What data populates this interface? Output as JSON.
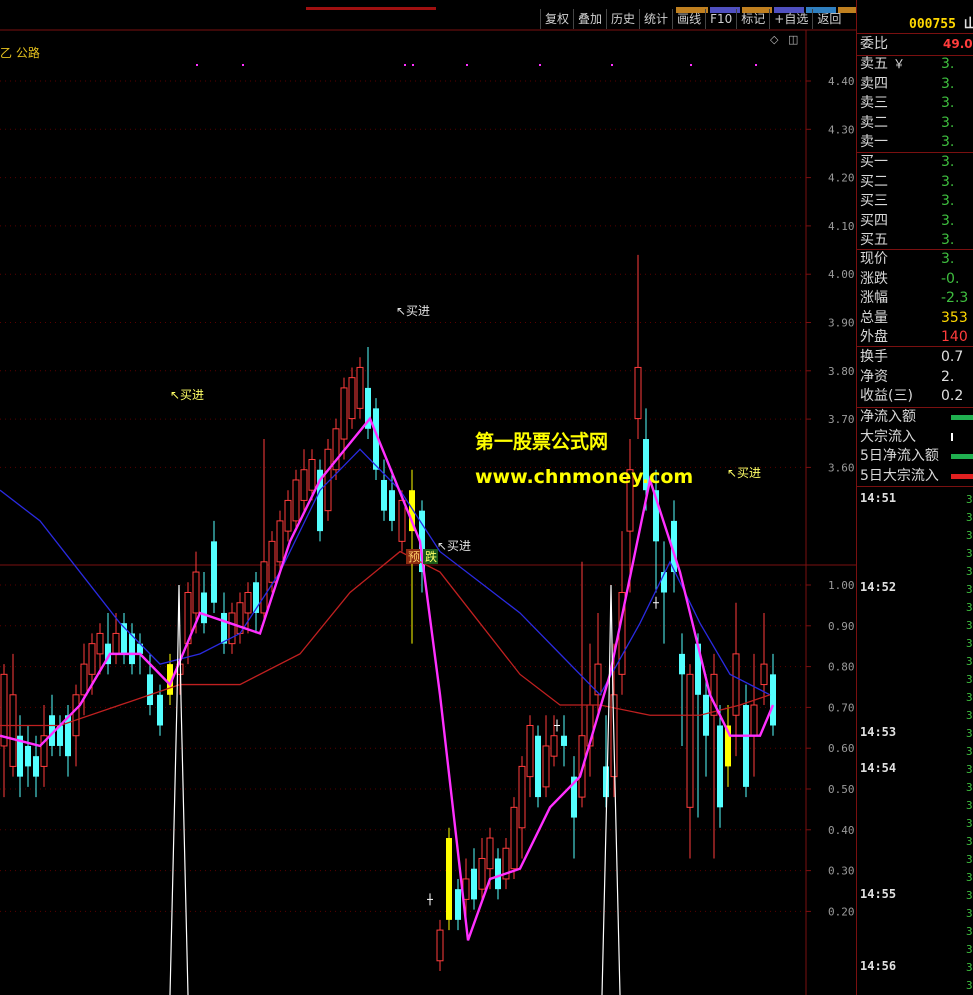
{
  "toolbar": [
    "复权",
    "叠加",
    "历史",
    "统计",
    "画线",
    "F10",
    "标记",
    "+自选",
    "返回"
  ],
  "indicator_name": "乙 公路",
  "corner_icons": {
    "diamond": "diamond-icon",
    "square": "window-icon"
  },
  "watermark": {
    "line1": "第一股票公式网",
    "line2": "www.chnmoney.com"
  },
  "annotations": {
    "buy1": "↖买进",
    "buy2": "↖买进",
    "buy3": "↖买进",
    "buy4": "↖买进",
    "pre": "预",
    "fall": "跌"
  },
  "colors": {
    "up": "#ff3c3c",
    "down": "#54ffff",
    "ma_blue": "#2a2ae0",
    "ma_red": "#c02020",
    "signal": "#ff30ff",
    "yellow": "#ffff00"
  },
  "price_axis": [
    "4.40",
    "4.30",
    "4.20",
    "4.10",
    "4.00",
    "3.90",
    "3.80",
    "3.70",
    "3.60"
  ],
  "ind_axis": [
    "1.00",
    "0.90",
    "0.80",
    "0.70",
    "0.60",
    "0.50",
    "0.40",
    "0.30",
    "0.20"
  ],
  "panel": {
    "code": "000755",
    "code_suffix": "山",
    "weibi_label": "委比",
    "weibi_value": "49.0",
    "asks": [
      {
        "label": "卖五",
        "extra": "￥",
        "val": "3."
      },
      {
        "label": "卖四",
        "extra": "",
        "val": "3."
      },
      {
        "label": "卖三",
        "extra": "",
        "val": "3."
      },
      {
        "label": "卖二",
        "extra": "",
        "val": "3."
      },
      {
        "label": "卖一",
        "extra": "",
        "val": "3."
      }
    ],
    "bids": [
      {
        "label": "买一",
        "val": "3."
      },
      {
        "label": "买二",
        "val": "3."
      },
      {
        "label": "买三",
        "val": "3."
      },
      {
        "label": "买四",
        "val": "3."
      },
      {
        "label": "买五",
        "val": "3."
      }
    ],
    "stats": [
      {
        "label": "现价",
        "val": "3.",
        "color": "#3fbf3f"
      },
      {
        "label": "涨跌",
        "val": "-0.",
        "color": "#3fbf3f"
      },
      {
        "label": "涨幅",
        "val": "-2.3",
        "color": "#3fbf3f"
      },
      {
        "label": "总量",
        "val": "353",
        "color": "#ffd800"
      },
      {
        "label": "外盘",
        "val": "140",
        "color": "#ff3c3c"
      }
    ],
    "stats2": [
      {
        "label": "换手",
        "val": "0.7",
        "color": "#e0e0e0"
      },
      {
        "label": "净资",
        "val": "2.",
        "color": "#e0e0e0"
      },
      {
        "label": "收益(三)",
        "val": "0.2",
        "color": "#e0e0e0"
      }
    ],
    "flows": [
      {
        "label": "净流入额",
        "bar": "#20b050"
      },
      {
        "label": "大宗流入",
        "bar": "#ffffff"
      },
      {
        "label": "5日净流入额",
        "bar": "#20b050"
      },
      {
        "label": "5日大宗流入",
        "bar": "#e02020"
      }
    ],
    "times": [
      "14:51",
      "14:52",
      "14:53",
      "14:54",
      "14:55",
      "14:56"
    ],
    "tick_value": "3."
  }
}
